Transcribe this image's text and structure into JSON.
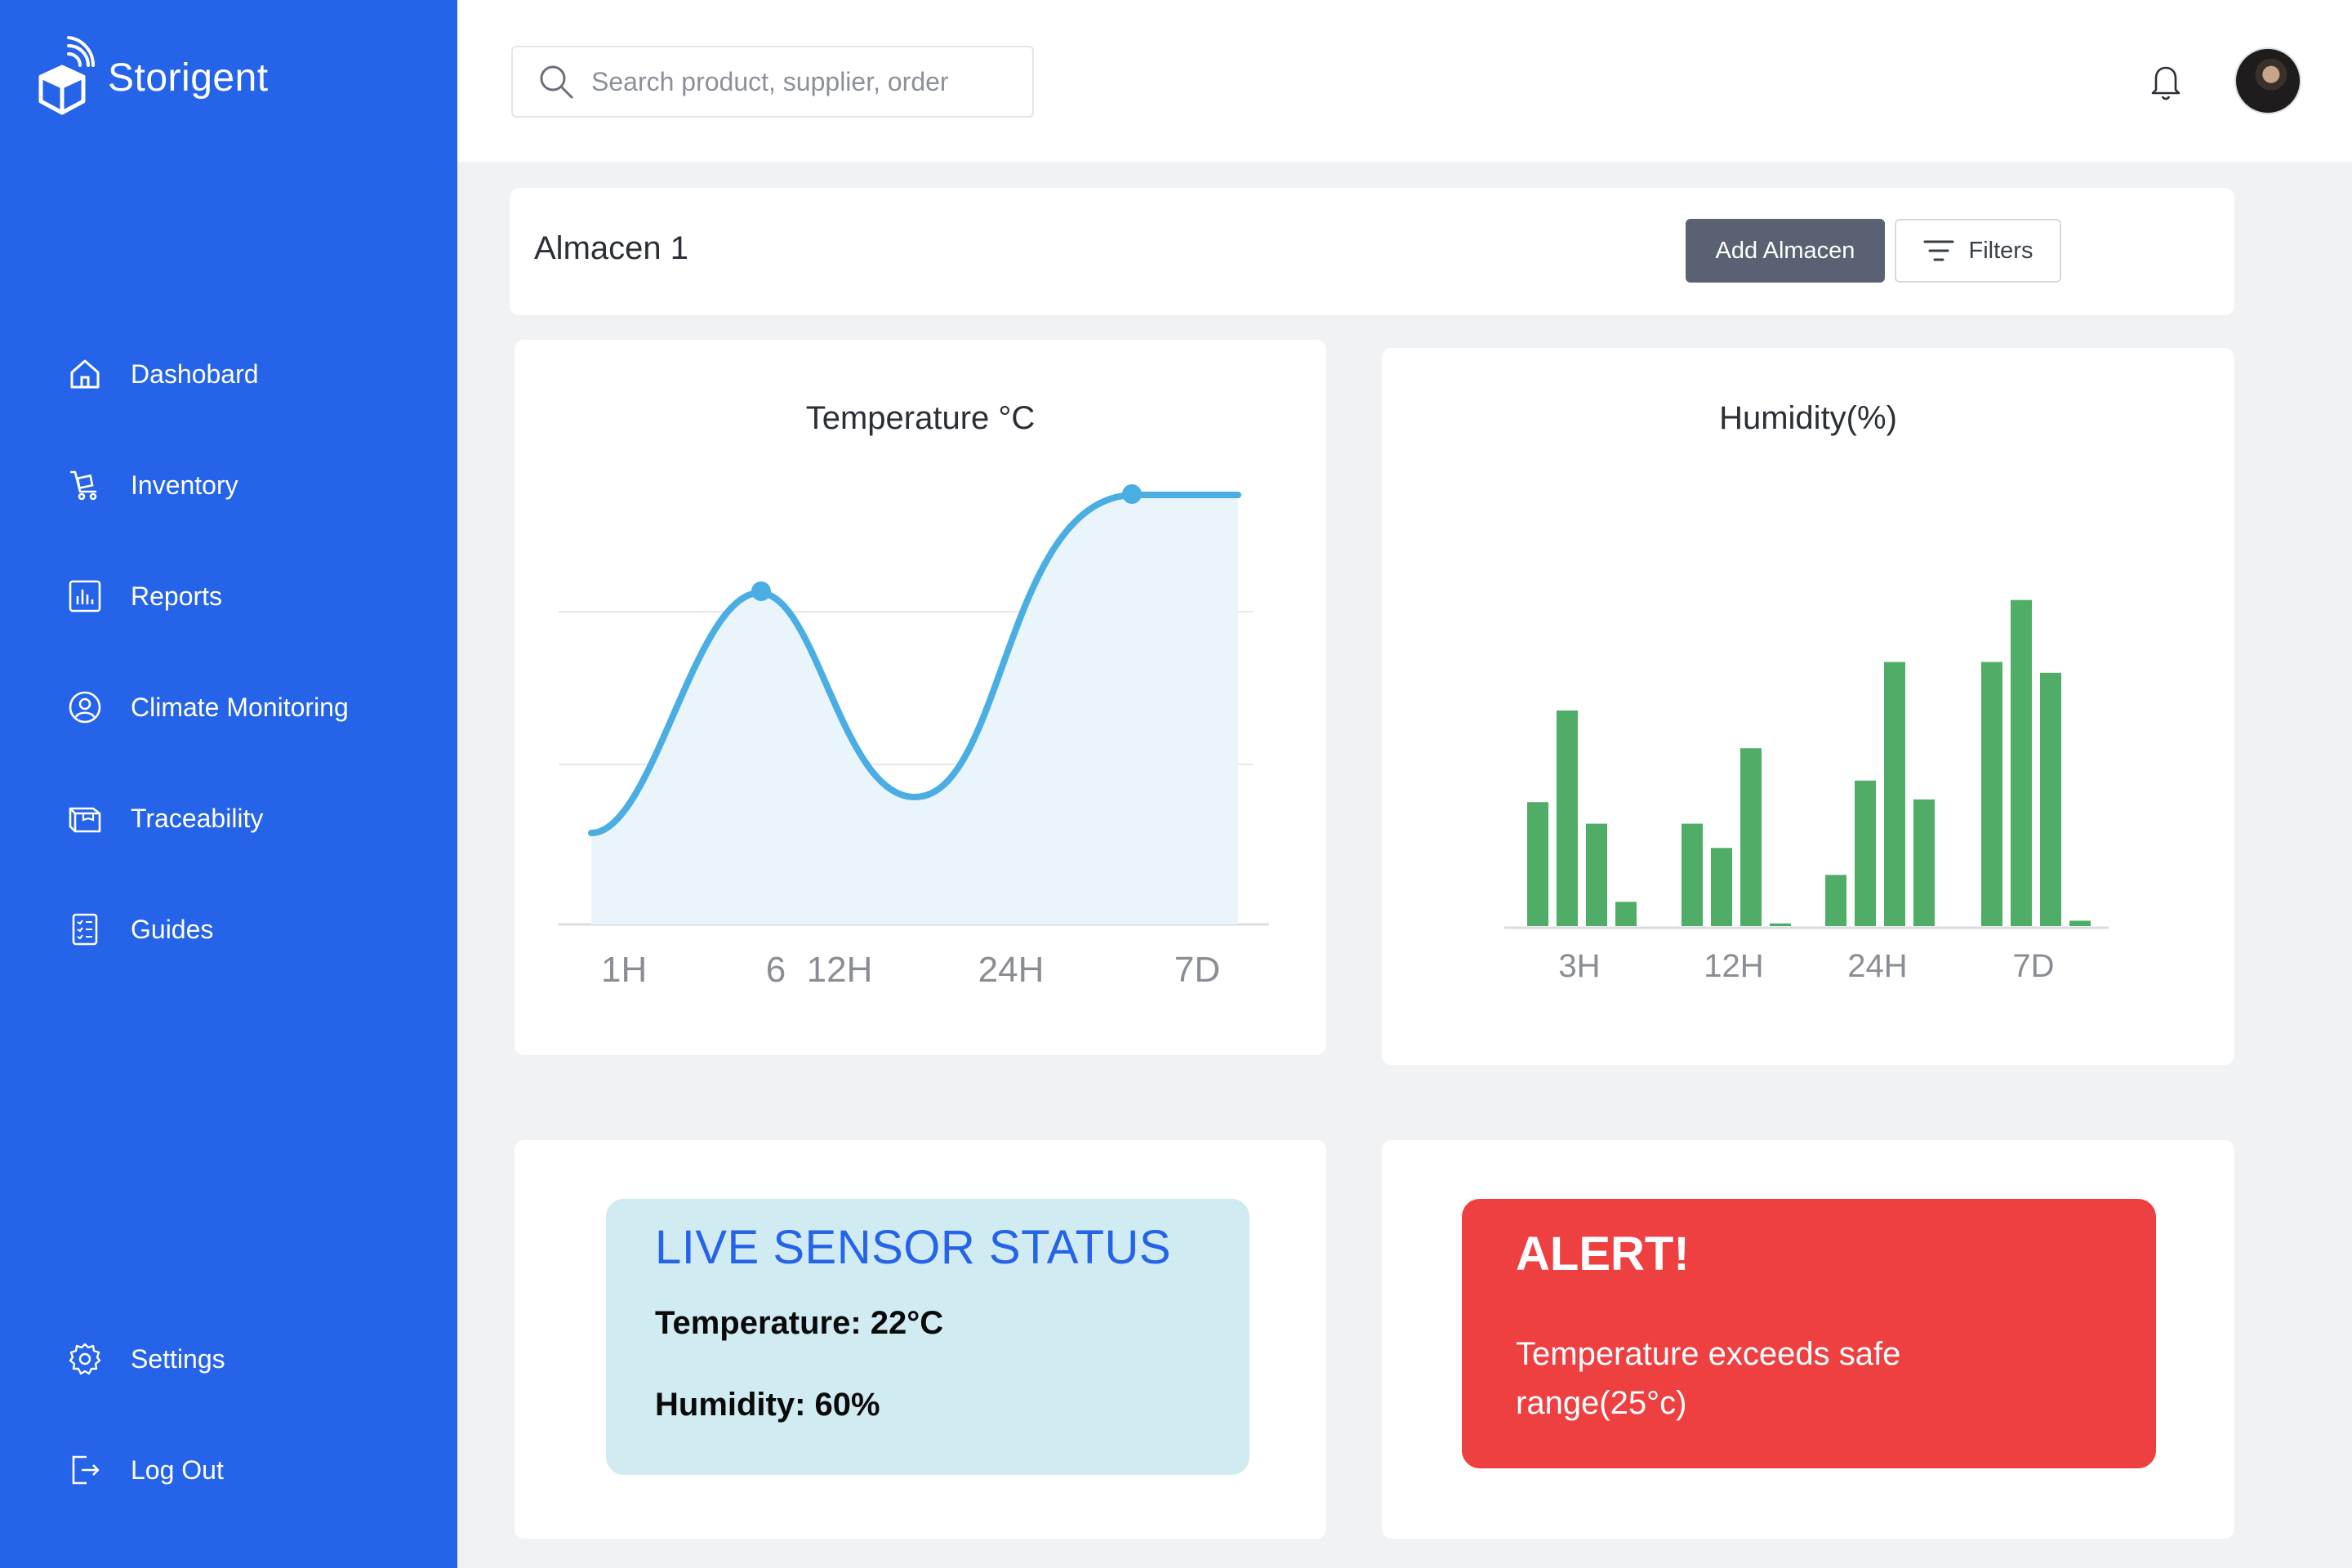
{
  "brand": {
    "name": "Storigent",
    "logo": "box-wifi-logo"
  },
  "sidebar": {
    "items": [
      {
        "label": "Dashobard",
        "icon": "home-icon"
      },
      {
        "label": "Inventory",
        "icon": "cart-icon"
      },
      {
        "label": "Reports",
        "icon": "bar-chart-icon"
      },
      {
        "label": "Climate Monitoring",
        "icon": "user-circle-icon"
      },
      {
        "label": "Traceability",
        "icon": "package-icon"
      },
      {
        "label": "Guides",
        "icon": "checklist-icon"
      }
    ],
    "bottom_items": [
      {
        "label": "Settings",
        "icon": "gear-icon"
      },
      {
        "label": "Log Out",
        "icon": "logout-icon"
      }
    ]
  },
  "topbar": {
    "search_placeholder": "Search product, supplier, order",
    "notification_icon": "bell-icon",
    "avatar": "user-avatar"
  },
  "header": {
    "title": "Almacen 1",
    "add_button": "Add Almacen",
    "filters_button": "Filters"
  },
  "chart_data": [
    {
      "type": "area",
      "title": "Temperature °C",
      "categories": [
        "1H",
        "6",
        "12H",
        "24H",
        "7D"
      ],
      "line_color": "#4baee3",
      "fill_color": "#eaf5fb"
    },
    {
      "type": "bar",
      "title": "Humidity(%)",
      "categories": [
        "3H",
        "12H",
        "24H",
        "7D"
      ],
      "bar_color": "#4fad68",
      "series": [
        {
          "values": [
            46,
            80,
            38,
            9
          ]
        },
        {
          "values": [
            38,
            29,
            66,
            1
          ]
        },
        {
          "values": [
            19,
            54,
            98,
            47
          ]
        },
        {
          "values": [
            98,
            121,
            94,
            2
          ]
        }
      ]
    }
  ],
  "sensor_status": {
    "title": "LIVE SENSOR STATUS",
    "temperature": "Temperature: 22°C",
    "humidity": "Humidity: 60%"
  },
  "alert": {
    "title": "ALERT!",
    "message": "Temperature exceeds safe range(25°c)",
    "color": "#ee3f41"
  },
  "colors": {
    "sidebar": "#2563e8",
    "accent_text": "#2563e8",
    "status_bg": "#d1ebf2"
  }
}
